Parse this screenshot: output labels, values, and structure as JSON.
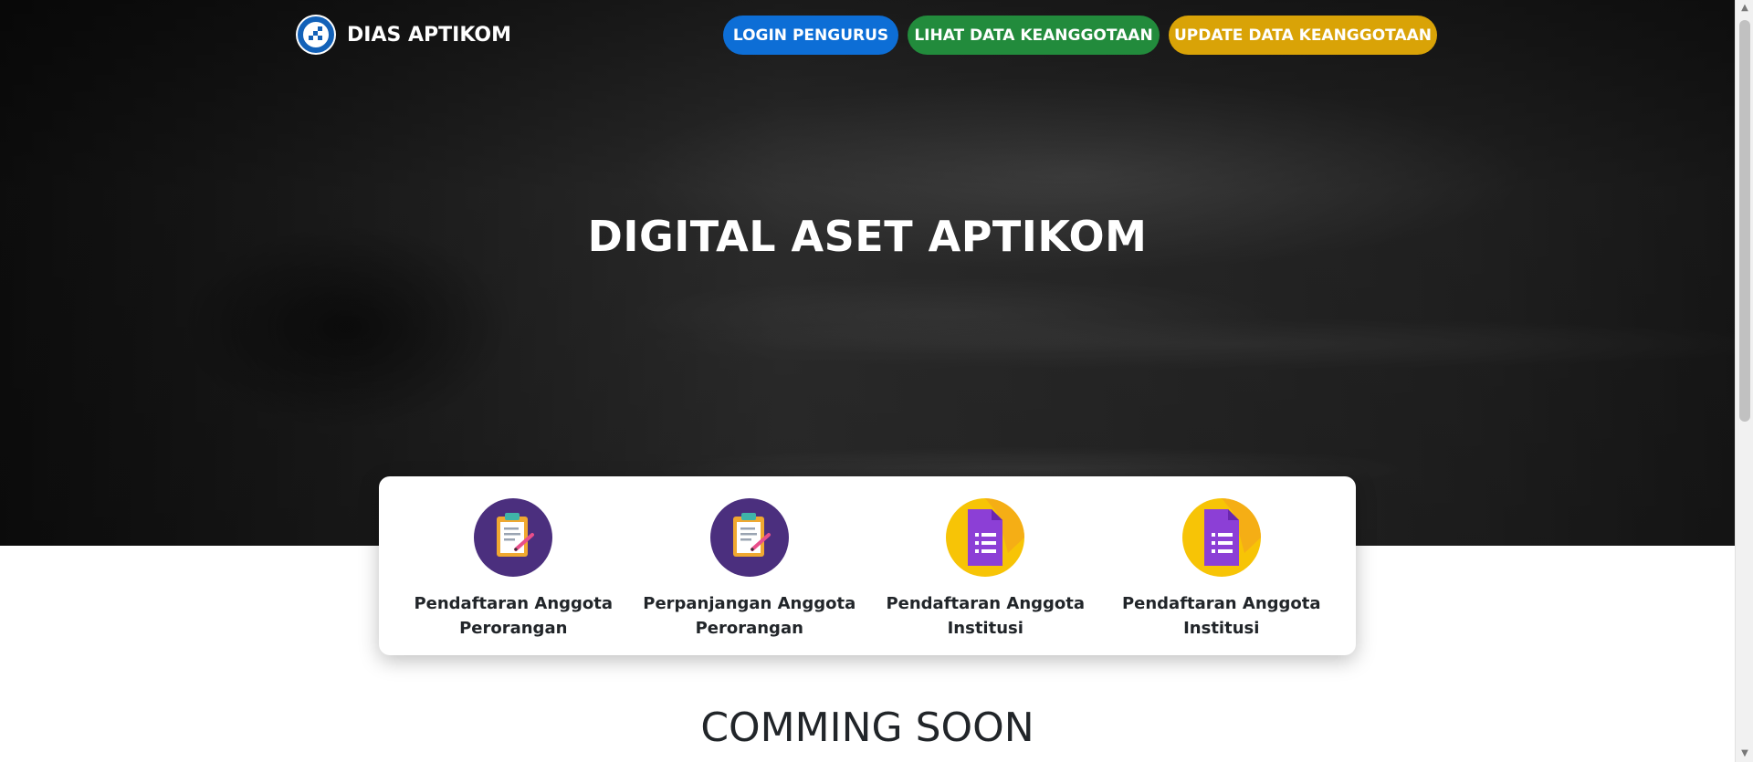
{
  "header": {
    "brand_name": "DIAS APTIKOM",
    "nav": [
      {
        "label": "LOGIN PENGURUS",
        "color": "#0d6ed6"
      },
      {
        "label": "LIHAT DATA KEANGGOTAAN",
        "color": "#228b3c"
      },
      {
        "label": "UPDATE DATA KEANGGOTAAN",
        "color": "#d9a307"
      }
    ]
  },
  "hero": {
    "title": "DIGITAL ASET APTIKOM"
  },
  "menu": [
    {
      "label": "Pendaftaran Anggota Perorangan",
      "icon": "clipboard-icon"
    },
    {
      "label": "Perpanjangan Anggota Perorangan",
      "icon": "clipboard-icon"
    },
    {
      "label": "Pendaftaran Anggota Institusi",
      "icon": "form-document-icon"
    },
    {
      "label": "Pendaftaran Anggota Institusi",
      "icon": "form-document-icon"
    }
  ],
  "section": {
    "coming_soon": "COMMING SOON"
  },
  "colors": {
    "clipboard_circle": "#4b2f7e",
    "form_circle": "#f7c406",
    "form_doc": "#8c3fd6"
  }
}
